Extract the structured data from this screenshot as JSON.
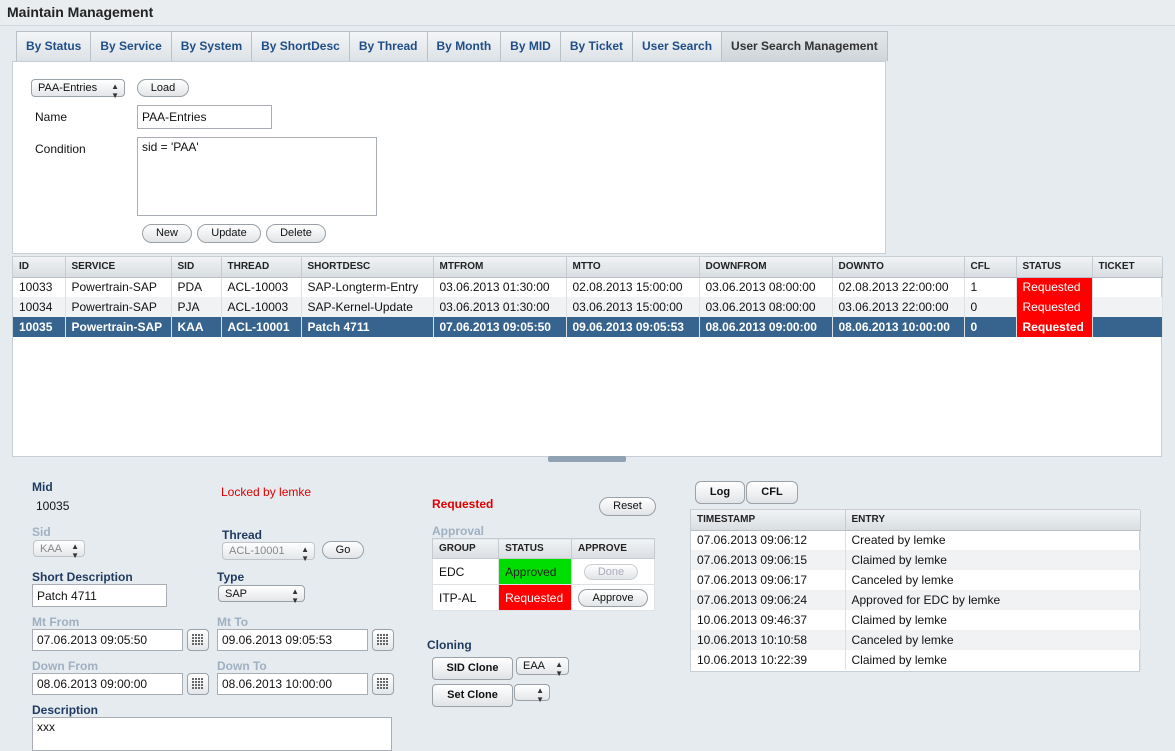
{
  "title": "Maintain Management",
  "tabs": [
    "By Status",
    "By Service",
    "By System",
    "By ShortDesc",
    "By Thread",
    "By Month",
    "By MID",
    "By Ticket",
    "User Search",
    "User Search Management"
  ],
  "search": {
    "saved_select": "PAA-Entries",
    "load_label": "Load",
    "name_label": "Name",
    "name_value": "PAA-Entries",
    "condition_label": "Condition",
    "condition_value": "sid =  'PAA'",
    "new_label": "New",
    "update_label": "Update",
    "delete_label": "Delete"
  },
  "grid": {
    "columns": [
      "ID",
      "SERVICE",
      "SID",
      "THREAD",
      "SHORTDESC",
      "MTFROM",
      "MTTO",
      "DOWNFROM",
      "DOWNTO",
      "CFL",
      "STATUS",
      "TICKET"
    ],
    "rows": [
      [
        "10033",
        "Powertrain-SAP",
        "PDA",
        "ACL-10003",
        "SAP-Longterm-Entry",
        "03.06.2013 01:30:00",
        "02.08.2013 15:00:00",
        "03.06.2013 08:00:00",
        "02.08.2013 22:00:00",
        "1",
        "Requested",
        ""
      ],
      [
        "10034",
        "Powertrain-SAP",
        "PJA",
        "ACL-10003",
        "SAP-Kernel-Update",
        "03.06.2013 01:30:00",
        "03.06.2013 15:00:00",
        "03.06.2013 08:00:00",
        "03.06.2013 22:00:00",
        "0",
        "Requested",
        ""
      ],
      [
        "10035",
        "Powertrain-SAP",
        "KAA",
        "ACL-10001",
        "Patch 4711",
        "07.06.2013 09:05:50",
        "09.06.2013 09:05:53",
        "08.06.2013 09:00:00",
        "08.06.2013 10:00:00",
        "0",
        "Requested",
        ""
      ]
    ]
  },
  "detail": {
    "mid_label": "Mid",
    "mid_value": "10035",
    "locked_text": "Locked by lemke",
    "sid_label": "Sid",
    "sid_value": "KAA",
    "thread_label": "Thread",
    "thread_value": "ACL-10001",
    "go_label": "Go",
    "shortdesc_label": "Short Description",
    "shortdesc_value": "Patch 4711",
    "type_label": "Type",
    "type_value": "SAP",
    "mtfrom_label": "Mt From",
    "mtfrom_value": "07.06.2013 09:05:50",
    "mtto_label": "Mt To",
    "mtto_value": "09.06.2013 09:05:53",
    "downfrom_label": "Down From",
    "downfrom_value": "08.06.2013 09:00:00",
    "downto_label": "Down To",
    "downto_value": "08.06.2013 10:00:00",
    "description_label": "Description",
    "description_value": "xxx"
  },
  "approval": {
    "status_text": "Requested",
    "reset_label": "Reset",
    "approval_label": "Approval",
    "columns": [
      "GROUP",
      "STATUS",
      "APPROVE"
    ],
    "rows": [
      {
        "group": "EDC",
        "status": "Approved",
        "action": "Done"
      },
      {
        "group": "ITP-AL",
        "status": "Requested",
        "action": "Approve"
      }
    ],
    "colors": {
      "approved": "#00dd00",
      "requested": "#ff0000"
    }
  },
  "cloning": {
    "label": "Cloning",
    "sid_clone_label": "SID Clone",
    "sid_clone_value": "EAA",
    "set_clone_label": "Set Clone",
    "set_clone_value": ""
  },
  "log": {
    "log_tab": "Log",
    "cfl_tab": "CFL",
    "columns": [
      "TIMESTAMP",
      "ENTRY"
    ],
    "rows": [
      [
        "07.06.2013 09:06:12",
        "Created by lemke"
      ],
      [
        "07.06.2013 09:06:15",
        "Claimed by lemke"
      ],
      [
        "07.06.2013 09:06:17",
        "Canceled by lemke"
      ],
      [
        "07.06.2013 09:06:24",
        "Approved for EDC by lemke"
      ],
      [
        "10.06.2013 09:46:37",
        "Claimed by lemke"
      ],
      [
        "10.06.2013 10:10:58",
        "Canceled by lemke"
      ],
      [
        "10.06.2013 10:22:39",
        "Claimed by lemke"
      ]
    ]
  }
}
